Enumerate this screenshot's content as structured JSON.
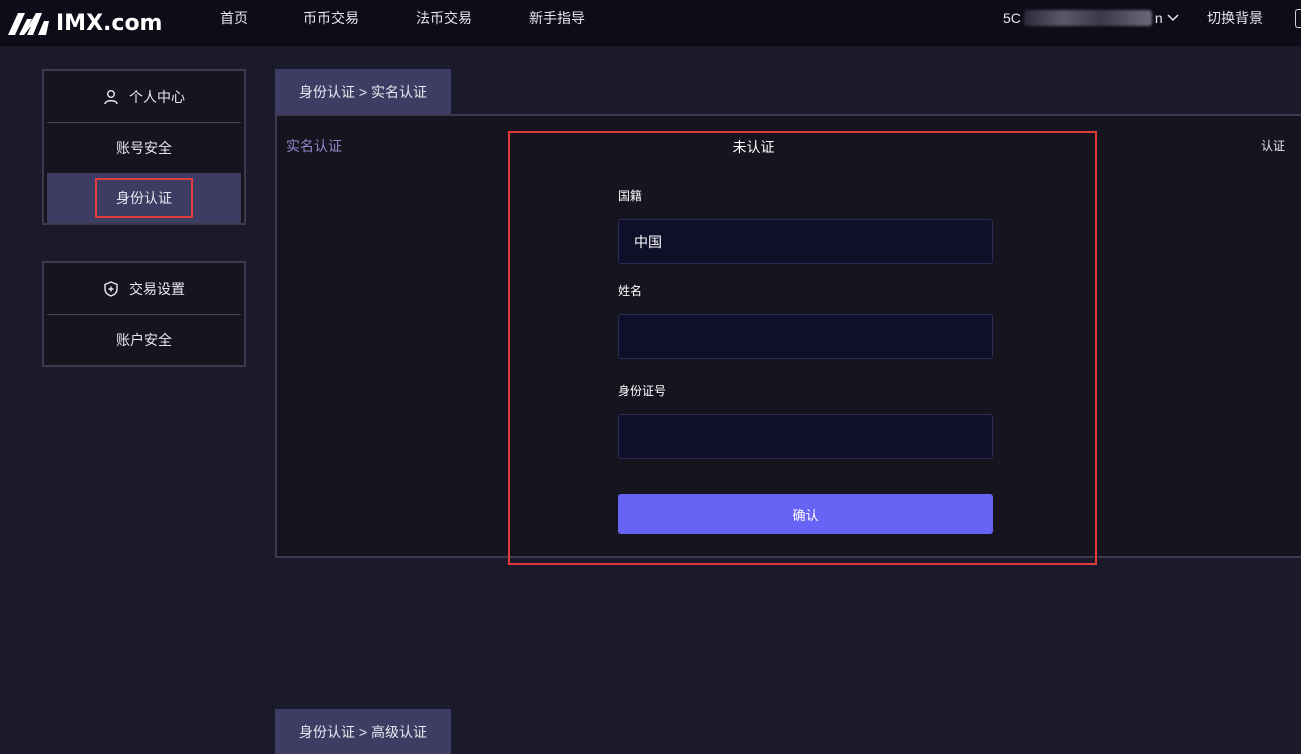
{
  "header": {
    "logo_text": "IMX.com",
    "nav": [
      "首页",
      "币币交易",
      "法币交易",
      "新手指导"
    ],
    "user_prefix": "5C",
    "user_suffix": "n",
    "switch_bg_label": "切换背景"
  },
  "sidebar": {
    "personal": {
      "title": "个人中心",
      "items": [
        "账号安全",
        "身份认证"
      ]
    },
    "trade": {
      "title": "交易设置",
      "items": [
        "账户安全"
      ]
    }
  },
  "main": {
    "tab_real_name": "身份认证 > 实名认证",
    "tab_advanced": "身份认证 > 高级认证",
    "section_label": "实名认证",
    "status": "未认证",
    "right_label": "认证",
    "form": {
      "nationality_label": "国籍",
      "nationality_value": "中国",
      "name_label": "姓名",
      "name_value": "",
      "id_label": "身份证号",
      "id_value": "",
      "confirm_label": "确认"
    }
  },
  "colors": {
    "background": "#1b1a2a",
    "topbar": "#0d0d19",
    "accent": "#6764f5",
    "highlight": "#e23b3b",
    "active_item": "#3d3c62"
  }
}
